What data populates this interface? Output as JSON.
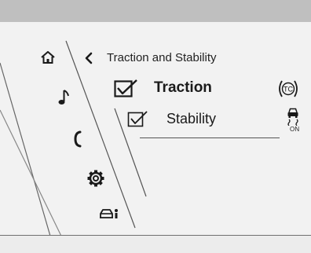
{
  "breadcrumb": {
    "title": "Traction and Stability"
  },
  "settings": [
    {
      "label": "Traction",
      "checked": true,
      "status_icon": "traction-control-icon"
    },
    {
      "label": "Stability",
      "checked": true,
      "status_icon": "stability-control-icon",
      "status_text": "ON"
    }
  ],
  "sidebar": {
    "items": [
      "home-icon",
      "music-note-icon",
      "phone-icon",
      "gear-icon",
      "vehicle-settings-icon"
    ]
  }
}
